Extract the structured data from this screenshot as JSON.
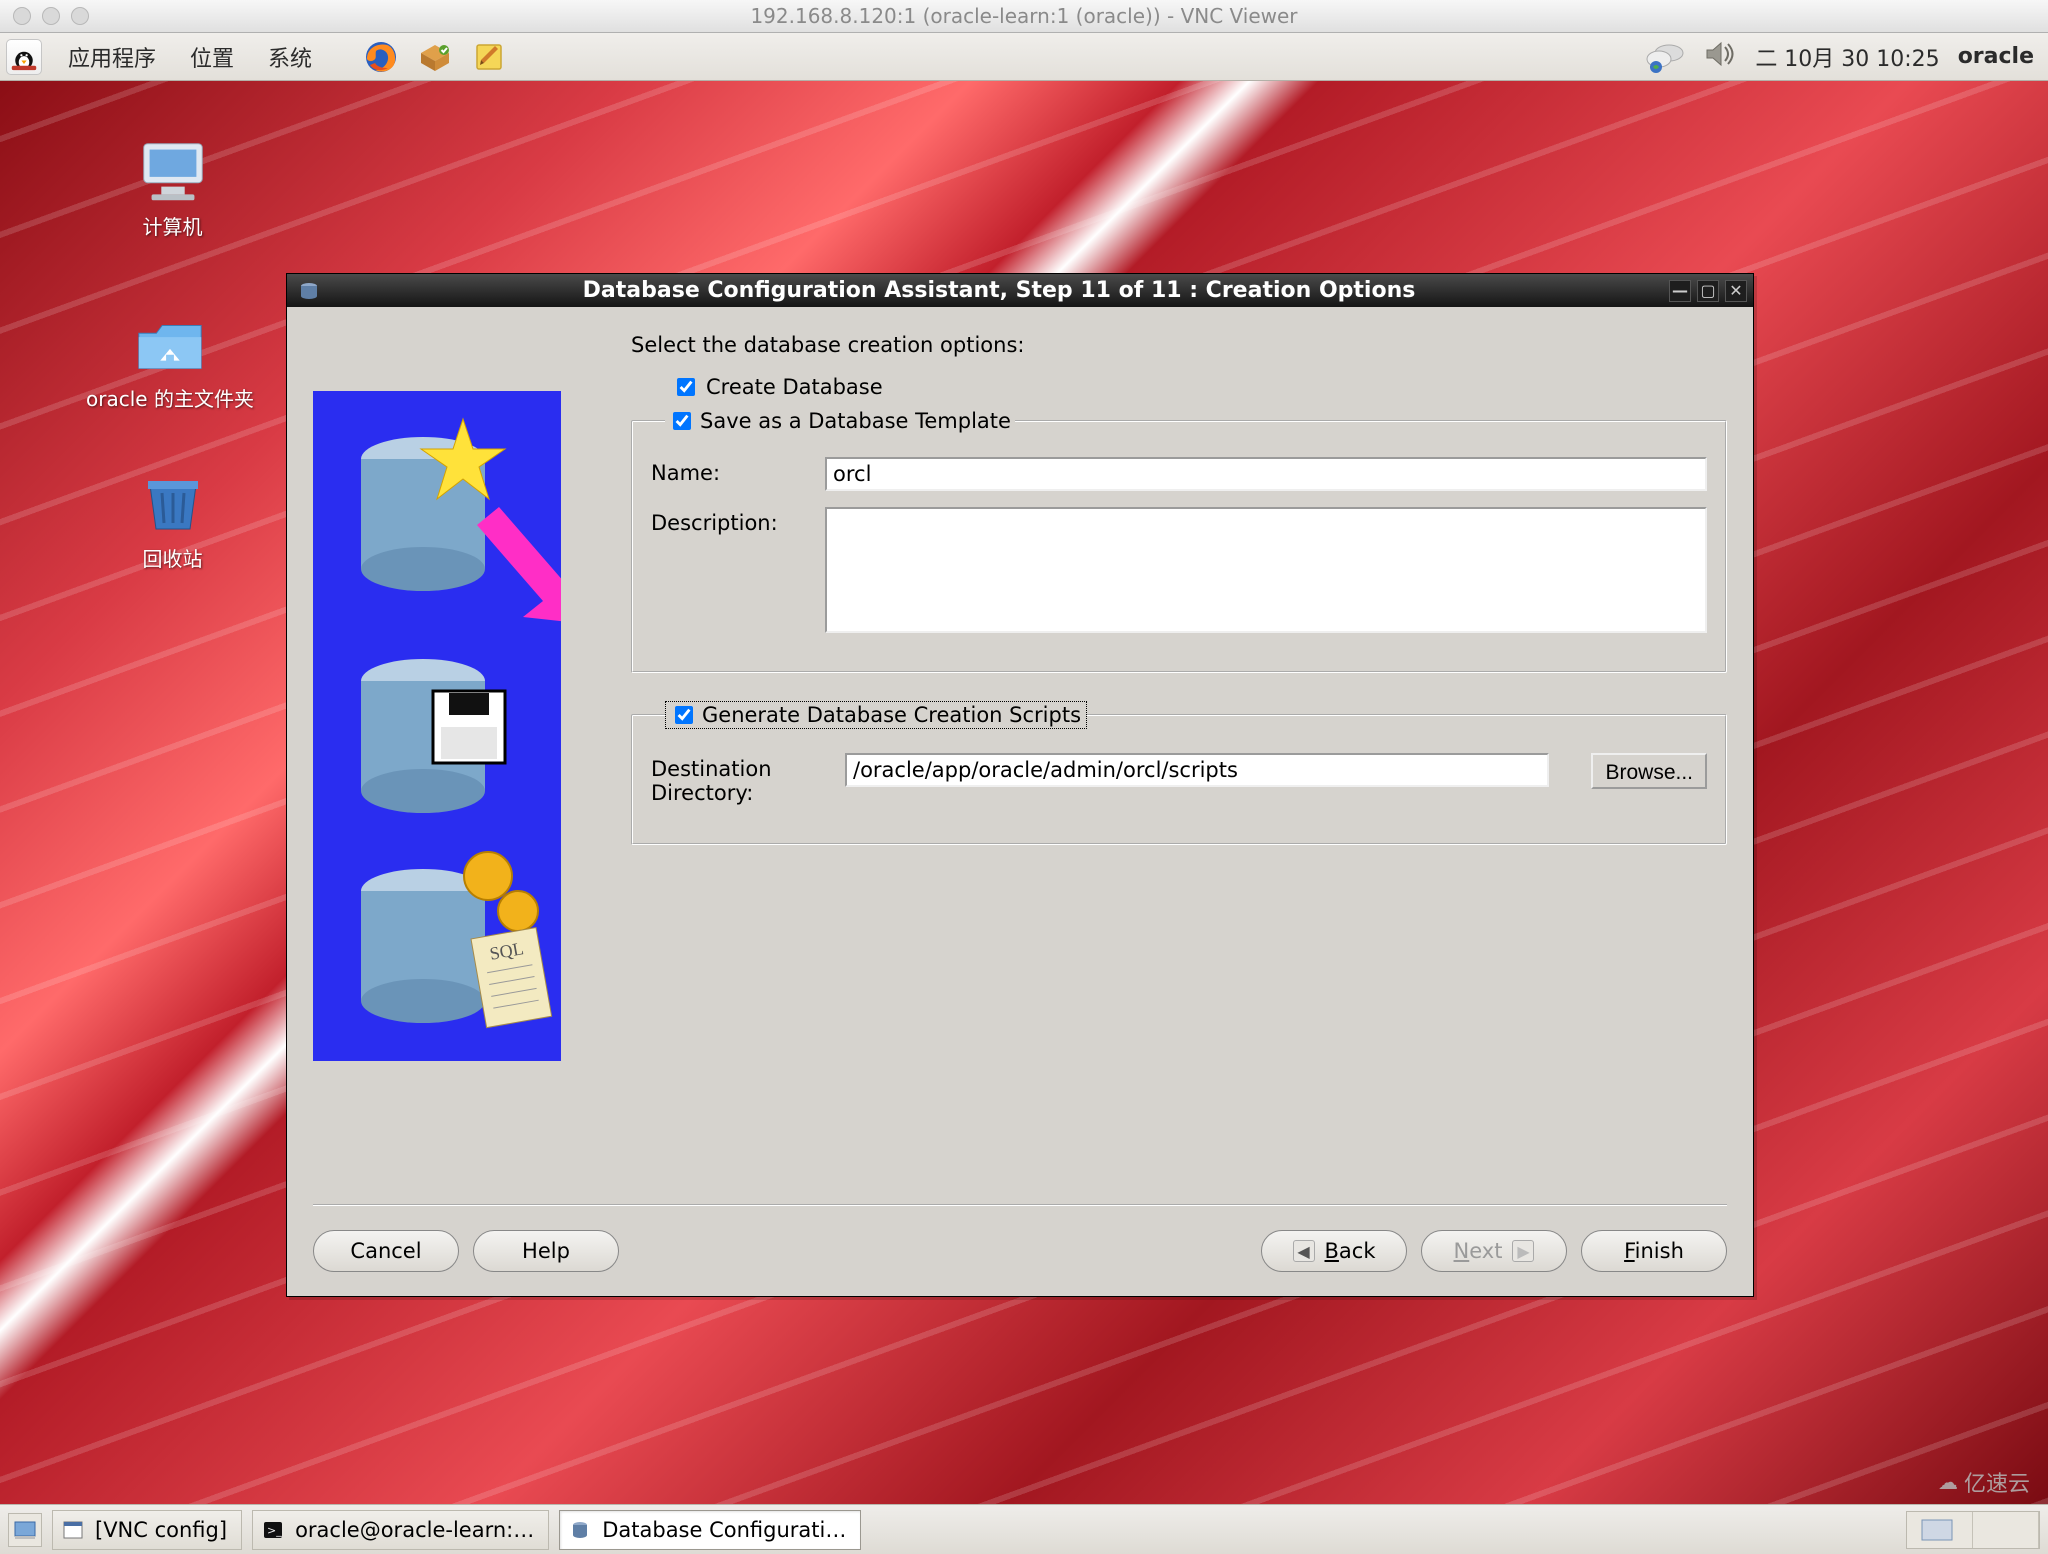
{
  "mac": {
    "title": "192.168.8.120:1 (oracle-learn:1 (oracle)) - VNC Viewer"
  },
  "panel": {
    "menu_apps": "应用程序",
    "menu_places": "位置",
    "menu_system": "系统",
    "clock": "二  10月  30 10:25",
    "user": "oracle"
  },
  "desktop": {
    "computer": "计算机",
    "home": "oracle 的主文件夹",
    "trash": "回收站"
  },
  "dbca": {
    "title": "Database Configuration Assistant, Step 11 of 11 : Creation Options",
    "instr": "Select the database creation options:",
    "cb_create": "Create Database",
    "cb_save_tpl": "Save as a Database Template",
    "name_label": "Name:",
    "name_value": "orcl",
    "desc_label": "Description:",
    "desc_value": "",
    "cb_gen_scripts": "Generate Database Creation Scripts",
    "dest_label": "Destination Directory:",
    "dest_value": "/oracle/app/oracle/admin/orcl/scripts",
    "browse": "Browse...",
    "cancel": "Cancel",
    "help": "Help",
    "back": "Back",
    "next": "Next",
    "finish": "Finish"
  },
  "taskbar": {
    "vnc": "[VNC config]",
    "term": "oracle@oracle-learn:…",
    "dbca": "Database Configurati…"
  },
  "watermark": "亿速云"
}
